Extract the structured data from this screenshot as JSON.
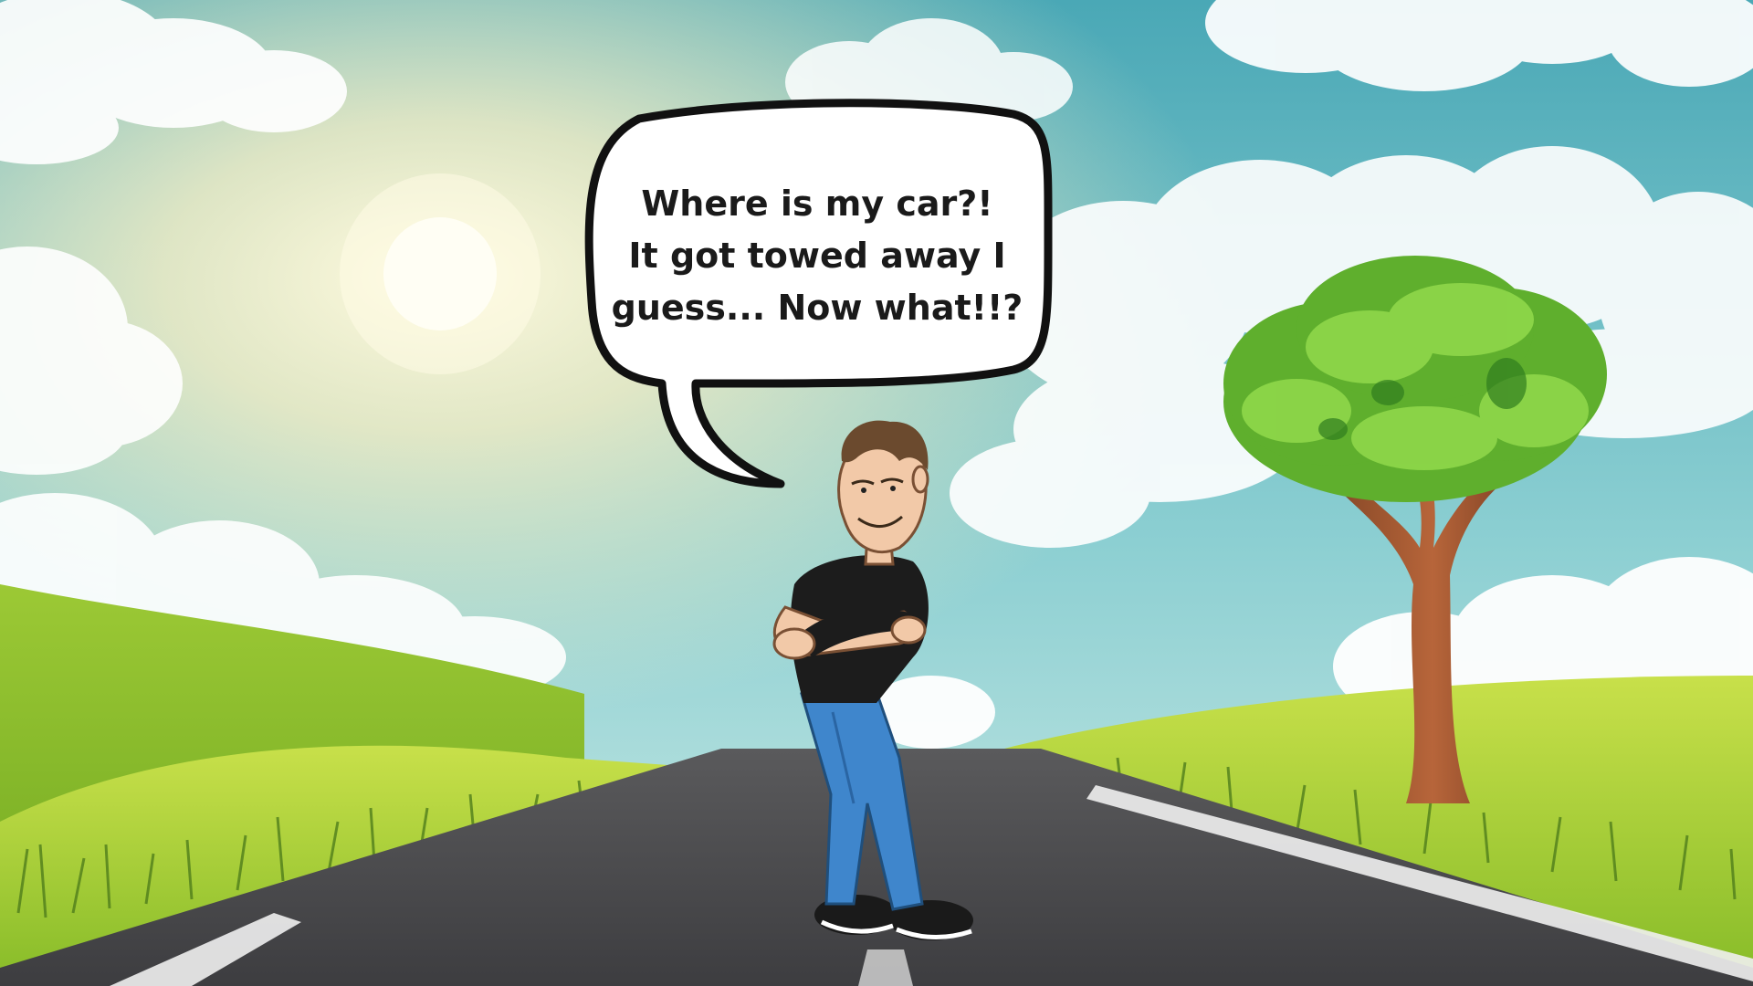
{
  "speech_bubble": {
    "lines": [
      "Where is my car?!",
      "It got towed away I",
      "guess... Now what!!?"
    ]
  },
  "icons": {
    "sun": "sun-icon",
    "tree": "tree-icon",
    "character": "man-arms-crossed-icon",
    "road": "road-icon"
  },
  "colors": {
    "sky_top": "#4fb0bd",
    "sky_haze": "#e9efc9",
    "grass_light": "#b9d83a",
    "grass_dark": "#6fa61f",
    "road": "#4a4a4d",
    "road_line": "#f2f2f2",
    "shirt": "#1c1c1c",
    "jeans": "#3f86cc",
    "hair": "#6b4a2e",
    "bubble_outline": "#111111"
  }
}
